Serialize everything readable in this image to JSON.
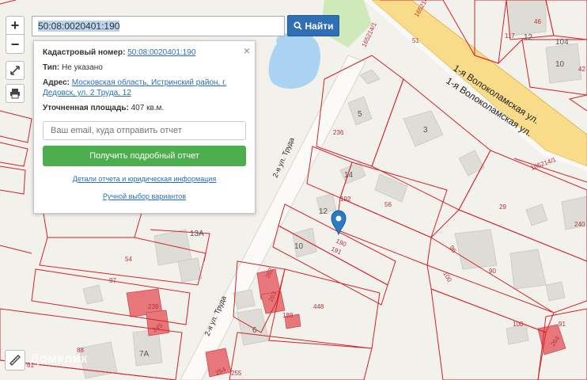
{
  "search": {
    "value": "50:08:0020401:190",
    "button_label": "Найти"
  },
  "popup": {
    "cadastral_label": "Кадастровый номер:",
    "cadastral_value": "50:08:0020401:190",
    "type_label": "Тип:",
    "type_value": "Не указано",
    "address_label": "Адрес:",
    "address_value": "Московская область, Истринский район, г. Дедовск, ул. 2 Труда, 12",
    "area_label": "Уточненная площадь:",
    "area_value": "407 кв.м.",
    "close_symbol": "×",
    "email_placeholder": "Ваш email, куда отправить отчет",
    "report_button": "Получить подробный отчет",
    "details_link": "Детали отчета и юридическая информация",
    "manual_link": "Ручной выбор вариантов"
  },
  "controls": {
    "zoom_in": "+",
    "zoom_out": "−"
  },
  "watermark": "Домклик",
  "map": {
    "streets": [
      "1-я Волоколамская ул.",
      "1-я Волоколамская ул.",
      "2-я ул. Труда",
      "2-я ул. Труда"
    ],
    "road_codes": [
      "165214/3",
      "165214/1",
      "165214/1"
    ],
    "house_numbers": [
      "12",
      "104",
      "10",
      "3",
      "5",
      "14",
      "12",
      "13А",
      "10",
      "6",
      "7А"
    ],
    "parcel_numbers": [
      "46",
      "117",
      "51",
      "42",
      "236",
      "192",
      "56",
      "29",
      "190",
      "191",
      "240",
      "96",
      "90",
      "100",
      "54",
      "97",
      "262",
      "263",
      "239",
      "245",
      "448",
      "188",
      "100",
      "91",
      "264",
      "88",
      "61",
      "254",
      "255"
    ],
    "colors": {
      "background": "#f3f1ec",
      "parcel_border": "#d2232a",
      "building": "#dddcd6",
      "highlight_building": "#e8777c",
      "road": "#f9dc8a",
      "water": "#aad3f2",
      "green": "#cfe9b8",
      "marker": "#2b7bc2"
    }
  }
}
